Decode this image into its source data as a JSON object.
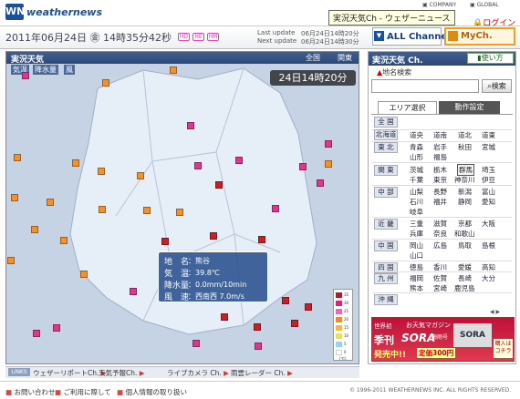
{
  "tooltip": "実況天気Ch - ウェザーニュース",
  "header": {
    "logo_mark": "WN",
    "logo_text": "weathernews",
    "links": [
      "COMPANY",
      "GLOBAL"
    ],
    "login": "ログイン"
  },
  "datebar": {
    "date": "2011年06月24日 ㊎ 14時35分42秒",
    "chips": [
      "HD",
      "HE",
      "HM"
    ],
    "last_update_label": "Last update",
    "last_update": "06月24日14時20分",
    "next_update_label": "Next update",
    "next_update": "06月24日14時30分",
    "all_channel": "ALL Channel",
    "all_channel_icon": "▼",
    "mych": "MyCh."
  },
  "map": {
    "title": "実況天気",
    "scope_links": [
      "全国",
      "関東"
    ],
    "tabs": [
      "気温",
      "降水量",
      "風"
    ],
    "time_badge": "24日14時20分",
    "popup": {
      "rows": [
        {
          "label": "地　名",
          "value": "：熊谷"
        },
        {
          "label": "気　温",
          "value": "：39.8℃"
        },
        {
          "label": "降水量",
          "value": "：0.0mm/10min"
        },
        {
          "label": "風　速",
          "value": "：西南西 7.0m/s"
        }
      ]
    },
    "legend": {
      "labels": [
        "35",
        "30",
        "25",
        "20",
        "15",
        "10",
        "5",
        "0"
      ],
      "unit": "(℃)",
      "colors": [
        "#b01c28",
        "#d8286c",
        "#e86ab4",
        "#f08a2c",
        "#f4b83a",
        "#e8e060",
        "#9ad0f0",
        "#ffffff"
      ]
    },
    "marker_colors": {
      "red": "#c8202a",
      "pink": "#dc3890",
      "orange": "#f2922e"
    }
  },
  "linkbar": {
    "label": "LINKS",
    "items": [
      "ウェザーリポートCh.",
      "天気予報Ch.",
      "ライブカメラ Ch.",
      "雨雲レーダー Ch."
    ]
  },
  "sidebar": {
    "title": "実況天気 Ch.",
    "howto": "使い方",
    "search_label": "地名検索",
    "search_placeholder": "",
    "search_button": "検索",
    "tab_area": "エリア選択",
    "tab_action": "動作設定",
    "all_japan": "全 国",
    "regions": [
      {
        "name": "北海道",
        "prefs": [
          "道央",
          "道南",
          "道北",
          "道東"
        ]
      },
      {
        "name": "東 北",
        "prefs": [
          "青森",
          "岩手",
          "秋田",
          "宮城",
          "山形",
          "福島"
        ]
      },
      {
        "name": "関 東",
        "prefs": [
          "茨城",
          "栃木",
          "群馬",
          "埼玉",
          "千葉",
          "東京",
          "神奈川",
          "伊豆"
        ]
      },
      {
        "name": "中 部",
        "prefs": [
          "山梨",
          "長野",
          "新潟",
          "富山",
          "石川",
          "福井",
          "静岡",
          "愛知",
          "岐阜"
        ]
      },
      {
        "name": "近 畿",
        "prefs": [
          "三重",
          "滋賀",
          "京都",
          "大阪",
          "兵庫",
          "奈良",
          "和歌山"
        ]
      },
      {
        "name": "中 国",
        "prefs": [
          "岡山",
          "広島",
          "鳥取",
          "島根",
          "山口"
        ]
      },
      {
        "name": "四 国",
        "prefs": [
          "徳島",
          "香川",
          "愛媛",
          "高知"
        ]
      },
      {
        "name": "九 州",
        "prefs": [
          "福岡",
          "佐賀",
          "長崎",
          "大分",
          "熊本",
          "宮崎",
          "鹿児島"
        ]
      },
      {
        "name": "沖 縄",
        "prefs": []
      }
    ],
    "selected_pref": "群馬",
    "banner": {
      "line1": "世界初",
      "line2": "お天気マガジン",
      "kikan": "季刊",
      "sora": "SORA",
      "tsuyu": "梅雨号",
      "sale": "発売中!!",
      "price": "定価300円",
      "cover": "SORA",
      "buy": "購入はコチラ"
    },
    "pager": "◀ ▶"
  },
  "footer": {
    "links": [
      "お問い合わせ",
      "ご利用に際して",
      "個人情報の取り扱い"
    ],
    "copyright": "© 1996-2011 WEATHERNEWS INC. ALL RIGHTS RESERVED."
  }
}
